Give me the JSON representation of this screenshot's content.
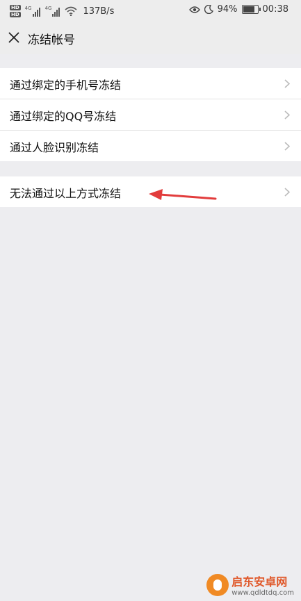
{
  "status_bar": {
    "network_speed": "137B/s",
    "battery": "94%",
    "battery_level": 0.94,
    "time": "00:38",
    "hd_badge": "HD",
    "net_type": "4G",
    "icons": [
      "hd-icon",
      "signal-icon",
      "wifi-icon",
      "eye-icon",
      "moon-icon",
      "battery-icon"
    ]
  },
  "header": {
    "title": "冻结帐号",
    "close_icon": "close-icon"
  },
  "menu": {
    "group1": [
      {
        "label": "通过绑定的手机号冻结"
      },
      {
        "label": "通过绑定的QQ号冻结"
      },
      {
        "label": "通过人脸识别冻结"
      }
    ],
    "group2": [
      {
        "label": "无法通过以上方式冻结"
      }
    ]
  },
  "annotation": {
    "arrow_color": "#e23c3c"
  },
  "watermark": {
    "name": "启东安卓网",
    "url": "www.qdldtdq.com"
  }
}
